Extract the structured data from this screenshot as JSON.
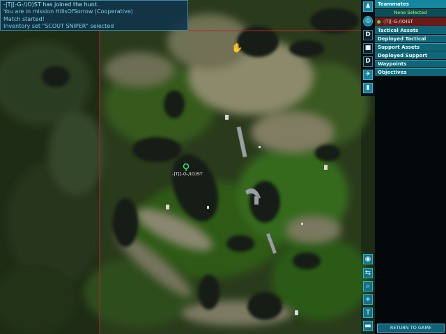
{
  "chat": {
    "lines": [
      "-|T|[-G-/(O)ST has joined the hunt.",
      "You are in mission HillsOfSorrow (Cooperative)",
      "Match started!",
      "Inventory set \"SCOUT SNIPER\" selected"
    ]
  },
  "map": {
    "player_label": "-|T|[-G-/(O)ST",
    "border_color": "#b8242c"
  },
  "side_icons": [
    {
      "name": "player-icon",
      "glyph": "♟"
    },
    {
      "name": "target-icon",
      "glyph": "◎"
    },
    {
      "name": "deployable-icon",
      "glyph": "D"
    },
    {
      "name": "turret-icon",
      "glyph": "■"
    },
    {
      "name": "deploy-support-icon",
      "glyph": "D"
    },
    {
      "name": "waypoint-icon",
      "glyph": "✈"
    },
    {
      "name": "objective-icon",
      "glyph": "▮"
    }
  ],
  "panel": {
    "header": "Teammates",
    "selection": "None Selected",
    "player_name": "-|T|[-G-/(O)ST",
    "menu": [
      "Tactical Assets",
      "Deployed Tactical",
      "Support Assets",
      "Deployed Support",
      "Waypoints",
      "Objectives"
    ],
    "return_label": "RETURN TO GAME"
  },
  "tools": [
    {
      "name": "center-icon",
      "glyph": "◉"
    },
    {
      "name": "move-icon",
      "glyph": "⇆"
    },
    {
      "name": "zoom-icon",
      "glyph": "⌕"
    },
    {
      "name": "crosshair-icon",
      "glyph": "+"
    },
    {
      "name": "text-icon",
      "glyph": "T"
    },
    {
      "name": "vehicle-icon",
      "glyph": "▬"
    }
  ]
}
